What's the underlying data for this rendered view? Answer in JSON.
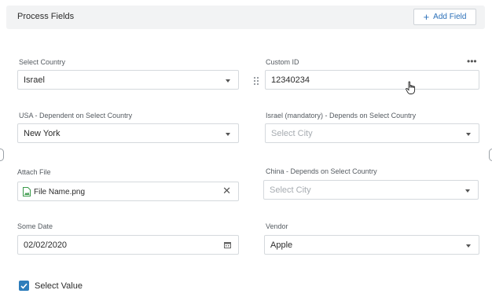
{
  "header": {
    "title": "Process Fields",
    "add_field_label": "Add Field",
    "add_icon": "plus-icon"
  },
  "fields": {
    "select_country": {
      "label": "Select Country",
      "value": "Israel"
    },
    "custom_id": {
      "label": "Custom ID",
      "value": "12340234"
    },
    "usa_dependent": {
      "label": "USA - Dependent on Select Country",
      "value": "New York"
    },
    "israel_mandatory": {
      "label": "Israel (mandatory) - Depends on Select Country",
      "placeholder": "Select City"
    },
    "attach_file": {
      "label": "Attach File",
      "file_name": "File Name.png"
    },
    "china_dependent": {
      "label": "China  - Depends on Select Country",
      "placeholder": "Select City"
    },
    "some_date": {
      "label": "Some Date",
      "value": "02/02/2020"
    },
    "vendor": {
      "label": "Vendor",
      "value": "Apple"
    }
  },
  "checkbox": {
    "label": "Select Value",
    "checked": true
  },
  "colors": {
    "accent": "#2a6fb8",
    "checkbox": "#2d7dbb",
    "header_bg": "#f2f3f4",
    "border": "#d5d9dd"
  }
}
